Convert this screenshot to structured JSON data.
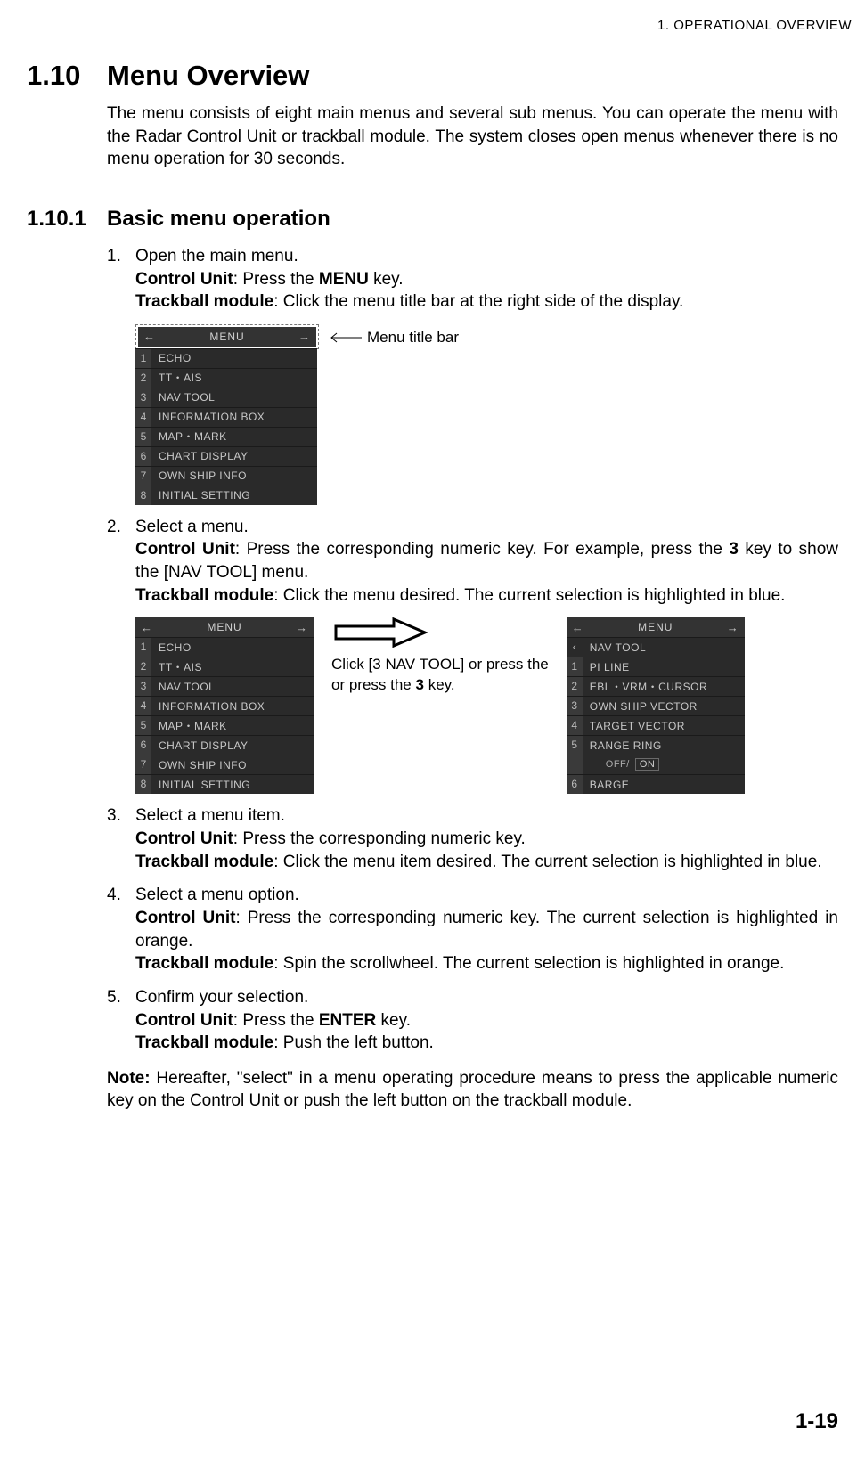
{
  "running_header": "1.  OPERATIONAL OVERVIEW",
  "section_number": "1.10",
  "section_title": "Menu Overview",
  "intro_text": "The menu consists of eight main menus and several sub menus. You can operate the menu with the Radar Control Unit or trackball module. The system closes open menus whenever there is no menu operation for 30 seconds.",
  "subsection_number": "1.10.1",
  "subsection_title": "Basic menu operation",
  "steps": {
    "s1": {
      "lead": "Open the main menu.",
      "cu_label": "Control Unit",
      "cu_text_a": ": Press the ",
      "cu_key": "MENU",
      "cu_text_b": " key.",
      "tb_label": "Trackball module",
      "tb_text": ": Click the menu title bar at the right side of the display."
    },
    "s2": {
      "lead": "Select a menu.",
      "cu_label": "Control Unit",
      "cu_text_a": ": Press the corresponding numeric key. For example, press the ",
      "cu_key": "3",
      "cu_text_b": " key to show the [NAV TOOL] menu.",
      "tb_label": "Trackball module",
      "tb_text": ": Click the menu desired. The current selection is highlighted in blue."
    },
    "s3": {
      "lead": "Select a menu item.",
      "cu_label": "Control Unit",
      "cu_text": ": Press the corresponding numeric key.",
      "tb_label": "Trackball module",
      "tb_text": ": Click the menu item desired. The current selection is highlighted in blue."
    },
    "s4": {
      "lead": "Select a menu option.",
      "cu_label": "Control Unit",
      "cu_text": ": Press the corresponding numeric key. The current selection is highlighted in orange.",
      "tb_label": "Trackball module",
      "tb_text": ": Spin the scrollwheel. The current selection is highlighted in orange."
    },
    "s5": {
      "lead": "Confirm your selection.",
      "cu_label": "Control Unit",
      "cu_text_a": ": Press the ",
      "cu_key": "ENTER",
      "cu_text_b": " key.",
      "tb_label": "Trackball module",
      "tb_text": ": Push the left button."
    }
  },
  "fig1": {
    "menu_title": "MENU",
    "items": [
      {
        "n": "1",
        "label": "ECHO"
      },
      {
        "n": "2",
        "label": "TT・AIS"
      },
      {
        "n": "3",
        "label": "NAV TOOL"
      },
      {
        "n": "4",
        "label": "INFORMATION BOX"
      },
      {
        "n": "5",
        "label": "MAP・MARK"
      },
      {
        "n": "6",
        "label": "CHART DISPLAY"
      },
      {
        "n": "7",
        "label": "OWN SHIP INFO"
      },
      {
        "n": "8",
        "label": "INITIAL SETTING"
      }
    ],
    "callout": "Menu title bar"
  },
  "fig2": {
    "caption_a": "Click [3 NAV TOOL] or press the ",
    "caption_key": "3",
    "caption_b": " key.",
    "left_title": "MENU",
    "right_title": "MENU",
    "left_items": [
      {
        "n": "1",
        "label": "ECHO"
      },
      {
        "n": "2",
        "label": "TT・AIS"
      },
      {
        "n": "3",
        "label": "NAV TOOL"
      },
      {
        "n": "4",
        "label": "INFORMATION BOX"
      },
      {
        "n": "5",
        "label": "MAP・MARK"
      },
      {
        "n": "6",
        "label": "CHART DISPLAY"
      },
      {
        "n": "7",
        "label": "OWN SHIP INFO"
      },
      {
        "n": "8",
        "label": "INITIAL SETTING"
      }
    ],
    "right_back": "NAV TOOL",
    "right_items": [
      {
        "n": "1",
        "label": "PI LINE"
      },
      {
        "n": "2",
        "label": "EBL・VRM・CURSOR"
      },
      {
        "n": "3",
        "label": "OWN SHIP VECTOR"
      },
      {
        "n": "4",
        "label": "TARGET VECTOR"
      },
      {
        "n": "5",
        "label": "RANGE RING"
      }
    ],
    "right_opt_off": "OFF/",
    "right_opt_on": "ON",
    "right_item6": {
      "n": "6",
      "label": "BARGE"
    }
  },
  "note_label": "Note:",
  "note_text": " Hereafter, \"select\" in a menu operating procedure means to press the applicable numeric key on the Control Unit or push the left button on the trackball module.",
  "page_number": "1-19"
}
